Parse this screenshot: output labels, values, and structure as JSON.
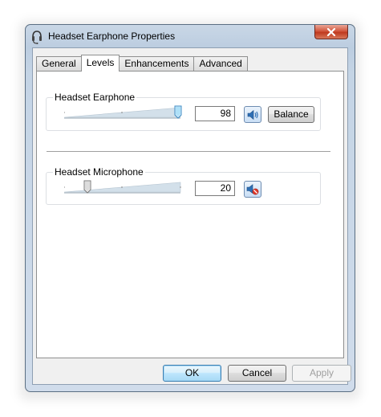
{
  "window": {
    "title": "Headset Earphone Properties",
    "app_icon": "headset-icon",
    "close_icon": "close-icon"
  },
  "tabs": [
    {
      "label": "General",
      "active": false
    },
    {
      "label": "Levels",
      "active": true
    },
    {
      "label": "Enhancements",
      "active": false
    },
    {
      "label": "Advanced",
      "active": false
    }
  ],
  "levels": {
    "earphone": {
      "label": "Headset Earphone",
      "value": "98",
      "level": 0.98,
      "speaker_icon": "speaker-icon",
      "muted": false,
      "balance_label": "Balance"
    },
    "microphone": {
      "label": "Headset Microphone",
      "value": "20",
      "level": 0.2,
      "speaker_icon": "speaker-muted-icon",
      "muted": true
    }
  },
  "footer": {
    "ok_label": "OK",
    "cancel_label": "Cancel",
    "apply_label": "Apply",
    "apply_enabled": false
  },
  "colors": {
    "close_button": "#c9462c",
    "default_button_border": "#3c7fb1",
    "slider_wedge": "#cfdde8"
  }
}
